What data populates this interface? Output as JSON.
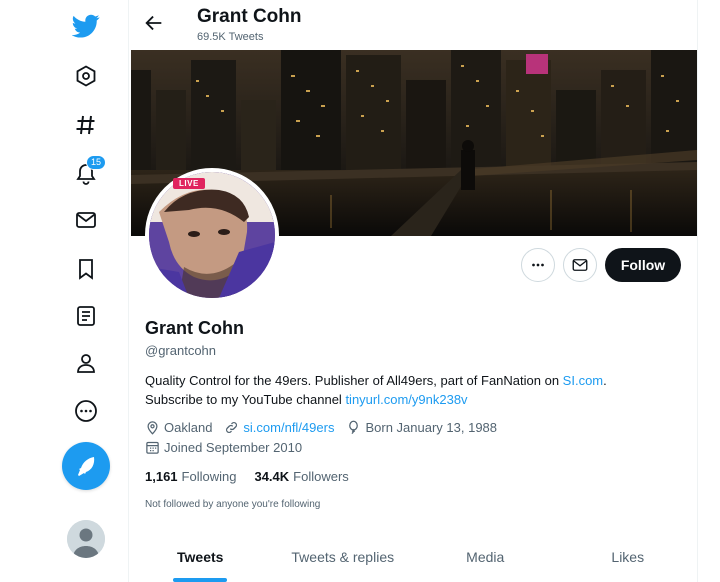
{
  "sidebar": {
    "notifications_badge": "15",
    "icons": [
      "twitter-logo-icon",
      "home-icon",
      "explore-hashtag-icon",
      "notifications-bell-icon",
      "messages-mail-icon",
      "bookmarks-icon",
      "lists-icon",
      "profile-icon",
      "more-icon",
      "compose-tweet-icon"
    ]
  },
  "header": {
    "name": "Grant Cohn",
    "tweet_count": "69.5K Tweets"
  },
  "profile": {
    "live_label": "LIVE",
    "name": "Grant Cohn",
    "handle": "@grantcohn",
    "bio_text_1": "Quality Control for the 49ers. Publisher of All49ers, part of FanNation on ",
    "bio_link_1": "SI.com",
    "bio_text_2": ".",
    "bio_text_3": "Subscribe to my YouTube channel ",
    "bio_link_2": "tinyurl.com/y9nk238v",
    "location": "Oakland",
    "website": "si.com/nfl/49ers",
    "birthday": "Born January 13, 1988",
    "joined": "Joined September 2010",
    "following_count": "1,161",
    "following_label": "Following",
    "followers_count": "34.4K",
    "followers_label": "Followers",
    "not_followed": "Not followed by anyone you're following"
  },
  "actions": {
    "follow_label": "Follow"
  },
  "tabs": [
    {
      "label": "Tweets",
      "active": true
    },
    {
      "label": "Tweets & replies",
      "active": false
    },
    {
      "label": "Media",
      "active": false
    },
    {
      "label": "Likes",
      "active": false
    }
  ],
  "colors": {
    "accent": "#1d9bf0",
    "text": "#0f1419",
    "secondary": "#536471",
    "follow_button": "#0f1419"
  }
}
